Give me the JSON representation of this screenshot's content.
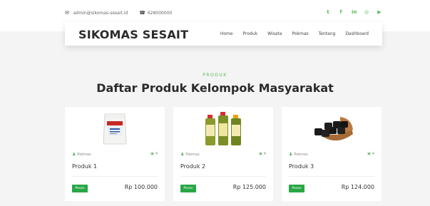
{
  "topbar": {
    "email": "admin@sikomas-sesait.id",
    "phone": "628000000",
    "socials": [
      "twitter-icon",
      "facebook-icon",
      "linkedin-icon",
      "instagram-icon",
      "youtube-icon"
    ],
    "accent": "#5cb85c"
  },
  "nav": {
    "brand": "SIKOMAS SESAIT",
    "items": [
      "Home",
      "Produk",
      "Wisata",
      "Pokmas",
      "Tentang",
      "Dashboard"
    ]
  },
  "section": {
    "eyebrow": "PRODUK",
    "title": "Daftar Produk Kelompok Masyarakat"
  },
  "products": [
    {
      "name": "Produk 1",
      "author": "Pokmas",
      "count": "4",
      "price": "Rp 100.000",
      "button": "Pesan",
      "image": "sack-image"
    },
    {
      "name": "Produk 2",
      "author": "Pokmas",
      "count": "4",
      "price": "Rp 125.000",
      "button": "Pesan",
      "image": "bottles-image"
    },
    {
      "name": "Produk 3",
      "author": "Pokmas",
      "count": "4",
      "price": "Rp 124.000",
      "button": "Pesan",
      "image": "charcoal-image"
    }
  ]
}
